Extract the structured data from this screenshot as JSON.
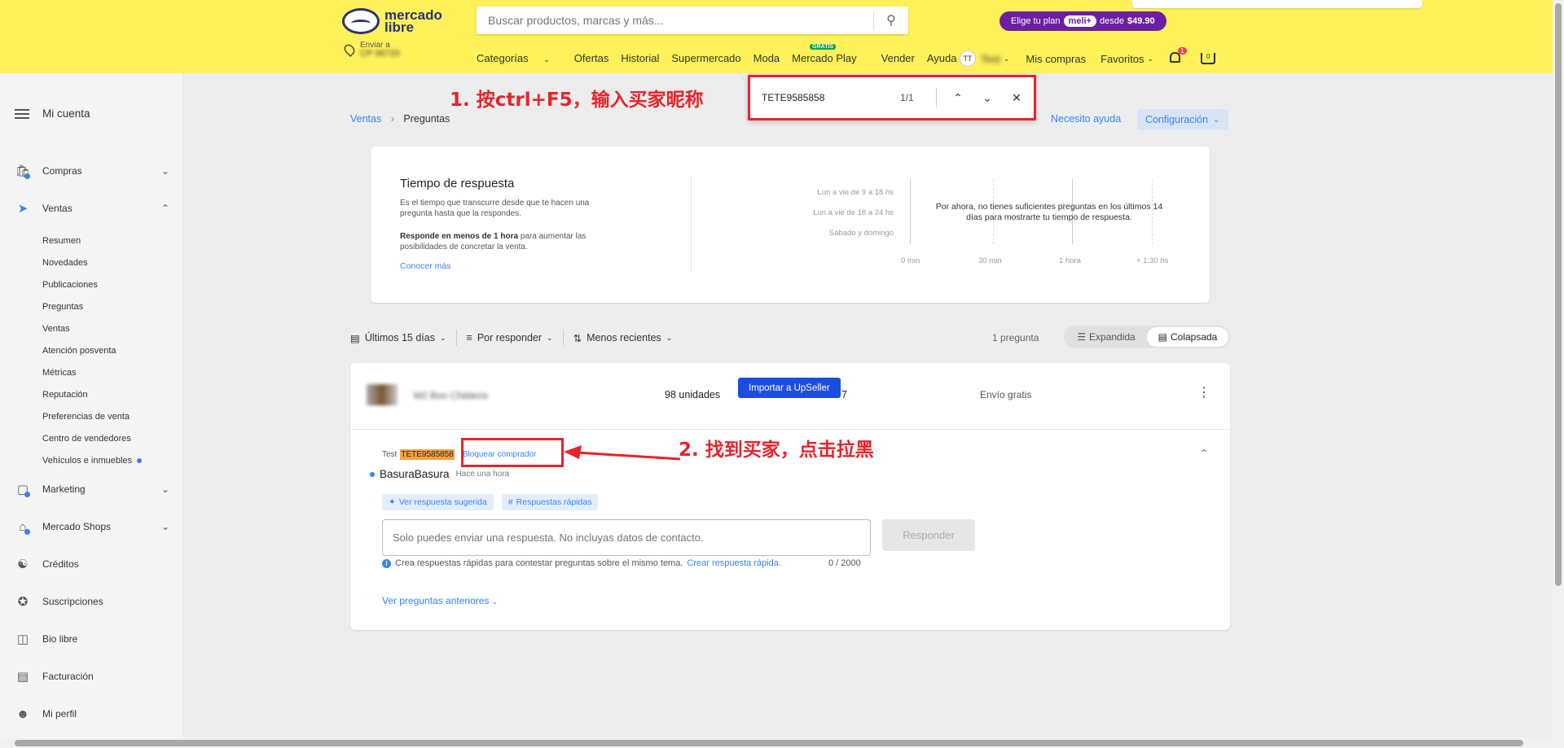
{
  "header": {
    "logo_line1": "mercado",
    "logo_line2": "libre",
    "search_placeholder": "Buscar productos, marcas y más...",
    "promo_prefix": "Elige tu plan",
    "promo_brand": "meli+",
    "promo_middle": "desde",
    "promo_price": "$49.90",
    "ship_label": "Enviar a",
    "ship_value": "CP 06720",
    "nav": [
      "Categorías",
      "Ofertas",
      "Historial",
      "Supermercado",
      "Moda",
      "Mercado Play",
      "Vender",
      "Ayuda"
    ],
    "nav_gratis_badge": "GRATIS",
    "user_initials": "TT",
    "user_name": "Test",
    "my_purchases": "Mis compras",
    "favorites": "Favoritos",
    "notif_count": "1",
    "cart_count": "0"
  },
  "sidebar": {
    "title": "Mi cuenta",
    "items": [
      {
        "label": "Compras",
        "icon": "bag-icon"
      },
      {
        "label": "Ventas",
        "icon": "tag-icon"
      },
      {
        "label": "Marketing",
        "icon": "marketing-icon"
      },
      {
        "label": "Mercado Shops",
        "icon": "shop-icon"
      },
      {
        "label": "Créditos",
        "icon": "credit-icon"
      },
      {
        "label": "Suscripciones",
        "icon": "star-icon"
      },
      {
        "label": "Bio libre",
        "icon": "bio-icon"
      },
      {
        "label": "Facturación",
        "icon": "invoice-icon"
      },
      {
        "label": "Mi perfil",
        "icon": "profile-icon"
      }
    ],
    "ventas_sub": [
      "Resumen",
      "Novedades",
      "Publicaciones",
      "Preguntas",
      "Ventas",
      "Atención posventa",
      "Métricas",
      "Reputación",
      "Preferencias de venta",
      "Centro de vendedores",
      "Vehículos e inmuebles"
    ]
  },
  "breadcrumb": {
    "parent": "Ventas",
    "current": "Preguntas"
  },
  "help_link": "Necesito ayuda",
  "config_label": "Configuración",
  "findbar": {
    "query": "TETE9585858",
    "count": "1/1"
  },
  "annotations": {
    "step1": "1. 按ctrl+F5，输入买家昵称",
    "step2": "2. 找到买家，点击拉黑"
  },
  "response_card": {
    "title": "Tiempo de respuesta",
    "p1": "Es el tiempo que transcurre desde que te hacen una pregunta hasta que la respondes.",
    "p2_bold": "Responde en menos de 1 hora",
    "p2_rest": " para aumentar las posibilidades de concretar la venta.",
    "more_link": "Conocer más",
    "rows": [
      "Lun a vie de 9 a 18 hs",
      "Lun a vie de 18 a 24 hs",
      "Sábado y domingo"
    ],
    "ticks": [
      "0 min",
      "30 min",
      "1 hora",
      "+ 1:30 hs"
    ],
    "message": "Por ahora, no tienes suficientes preguntas en los últimos 14 días para mostrarte tu tiempo de respuesta."
  },
  "filters": {
    "period": "Últimos 15 días",
    "status": "Por responder",
    "order": "Menos recientes",
    "count": "1 pregunta",
    "view_expanded": "Expandida",
    "view_collapsed": "Colapsada"
  },
  "question": {
    "product_title": "M2 Bon Childeris",
    "units": "98 unidades",
    "units_suffix": "7",
    "import_button": "Importar a UpSeller",
    "shipping": "Envío gratis",
    "asker_prefix": "Test",
    "asker_nick": "TETE9585858",
    "block_link": "Bloquear comprador",
    "text": "BasuraBasura",
    "time_ago": "Hace una hora",
    "chip_suggested": "Ver respuesta sugerida",
    "chip_quick": "Respuestas rápidas",
    "answer_placeholder": "Solo puedes enviar una respuesta. No incluyas datos de contacto.",
    "respond_button": "Responder",
    "hint_text": "Crea respuestas rápidas para contestar preguntas sobre el mismo tema.",
    "hint_link": "Crear respuesta rápida.",
    "char_count": "0 / 2000",
    "prev_link": "Ver preguntas anteriores"
  }
}
